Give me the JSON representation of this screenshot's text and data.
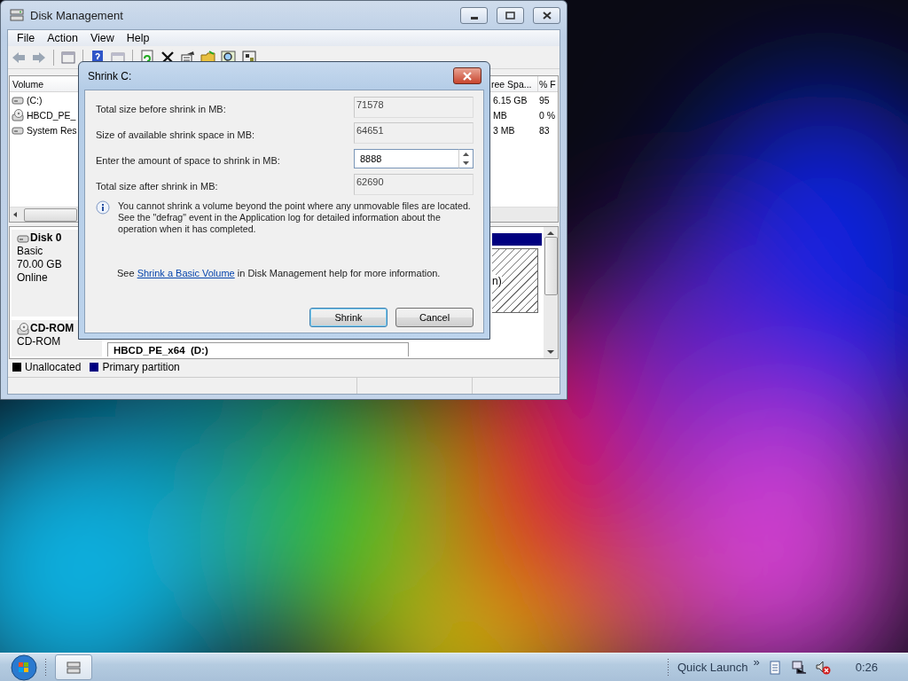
{
  "window": {
    "title": "Disk Management",
    "menu": [
      "File",
      "Action",
      "View",
      "Help"
    ],
    "volume_list": {
      "columns": [
        "Volume",
        "ree Spa...",
        "% F"
      ],
      "rows": [
        {
          "kind": "disk",
          "cells": [
            "(C:)",
            "6.15 GB",
            "95"
          ]
        },
        {
          "kind": "cd",
          "cells": [
            "HBCD_PE_",
            "MB",
            "0 %"
          ]
        },
        {
          "kind": "disk",
          "cells": [
            "System Res",
            "3 MB",
            "83"
          ]
        }
      ]
    },
    "disks": [
      {
        "kind": "disk",
        "name": "Disk 0",
        "lines": [
          "Basic",
          "70.00 GB",
          "Online"
        ],
        "partition": "n)"
      },
      {
        "kind": "cd",
        "name": "CD-ROM",
        "lines": [
          "CD-ROM"
        ],
        "partition": "HBCD_PE_x64  (D:)"
      }
    ],
    "legend": [
      {
        "label": "Unallocated",
        "color": "#000000"
      },
      {
        "label": "Primary partition",
        "color": "#000080"
      }
    ]
  },
  "dialog": {
    "title": "Shrink C:",
    "fields": [
      {
        "kind": "readonly",
        "label": "Total size before shrink in MB:",
        "value": "71578"
      },
      {
        "kind": "readonly",
        "label": "Size of available shrink space in MB:",
        "value": "64651"
      },
      {
        "kind": "spin",
        "label": "Enter the amount of space to shrink in MB:",
        "value": "8888"
      },
      {
        "kind": "readonly",
        "label": "Total size after shrink in MB:",
        "value": "62690"
      }
    ],
    "info": "You cannot shrink a volume beyond the point where any unmovable files are located. See the \"defrag\" event in the Application log for detailed information about the operation when it has completed.",
    "help": {
      "before": "See",
      "link": "Shrink a Basic Volume",
      "after": "in Disk Management help for more information."
    },
    "buttons": [
      {
        "label": "Shrink",
        "default": true
      },
      {
        "label": "Cancel",
        "default": false
      }
    ]
  },
  "taskbar": {
    "quick_launch": "Quick Launch",
    "chevron": "»",
    "clock": "0:26"
  }
}
